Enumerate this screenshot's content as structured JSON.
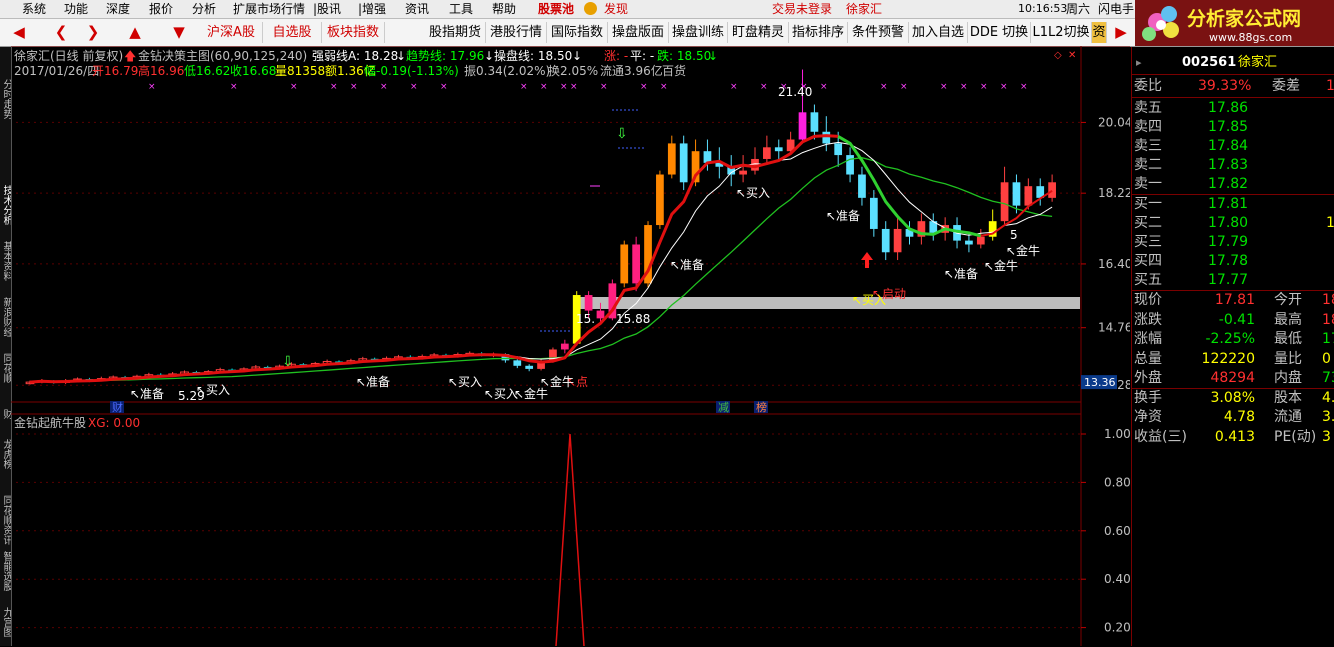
{
  "menubar": {
    "items": [
      "系统",
      "功能",
      "深度",
      "报价",
      "分析",
      "扩展市场行情",
      "|股讯",
      "|增强",
      "资讯",
      "工具",
      "帮助"
    ],
    "stock_pool": "股票池",
    "discover": "发现",
    "login_status": "交易未登录",
    "stock_name": "徐家汇",
    "time": "10:16:53",
    "weekday": "周六",
    "flash_trade": "闪电手"
  },
  "toolbar": {
    "tabs": [
      "沪深A股",
      "自选股",
      "板块指数",
      "股指期货",
      "港股行情",
      "国际指数",
      "操盘版面",
      "操盘训练",
      "盯盘精灵",
      "指标排序",
      "条件预警",
      "加入自选",
      "DDE 切换",
      "L1L2切换",
      "资"
    ]
  },
  "logo": {
    "text": "分析家公式网",
    "url": "www.88gs.com"
  },
  "chart_header": {
    "title": "徐家汇(日线 前复权)",
    "formula": "金钻决策主图(60,90,125,240)",
    "strong_line": "强弱线A: 18.28",
    "trend_line": "趋势线: 17.96",
    "op_line": "操盘线: 18.50",
    "zhang": "涨: -",
    "ping": "平: -",
    "die": "跌: 18.50",
    "info_date": "2017/01/26/四",
    "info_open": "开16.79",
    "info_high": "高16.96",
    "info_low": "低16.62",
    "info_close": "收16.68",
    "info_vol": "量81358",
    "info_amt": "额1.36亿",
    "info_chg": "幅-0.19(-1.13%)",
    "info_amp": "振0.34(2.02%)",
    "info_turn": "换2.05%",
    "info_float": "流通3.96亿",
    "info_sector": "百货"
  },
  "lower_panel": {
    "title": "金钻起航牛股",
    "xg": "XG: 0.00"
  },
  "left_tabs": [
    "分时走势",
    "技术分析",
    "基本资料",
    "新浪财经",
    "同花顺",
    "财",
    "龙虎榜",
    "同花顺资讯",
    "智能选股",
    "九宫图"
  ],
  "quote": {
    "code": "002561",
    "name": "徐家汇",
    "weibi_label": "委比",
    "weibi_value": "39.33%",
    "weicha_label": "委差",
    "weicha_value": "1",
    "sells": [
      {
        "label": "卖五",
        "price": "17.86"
      },
      {
        "label": "卖四",
        "price": "17.85"
      },
      {
        "label": "卖三",
        "price": "17.84"
      },
      {
        "label": "卖二",
        "price": "17.83"
      },
      {
        "label": "卖一",
        "price": "17.82"
      }
    ],
    "buys": [
      {
        "label": "买一",
        "price": "17.81",
        "vol": ""
      },
      {
        "label": "买二",
        "price": "17.80",
        "vol": "1"
      },
      {
        "label": "买三",
        "price": "17.79",
        "vol": ""
      },
      {
        "label": "买四",
        "price": "17.78",
        "vol": ""
      },
      {
        "label": "买五",
        "price": "17.77",
        "vol": ""
      }
    ],
    "stats": [
      {
        "l1": "现价",
        "v1": "17.81",
        "l2": "今开",
        "v2": "18",
        "c1": "#ff3030",
        "c2": "#ff3030"
      },
      {
        "l1": "涨跌",
        "v1": "-0.41",
        "l2": "最高",
        "v2": "18",
        "c1": "#00e000",
        "c2": "#ff3030"
      },
      {
        "l1": "涨幅",
        "v1": "-2.25%",
        "l2": "最低",
        "v2": "17",
        "c1": "#00e000",
        "c2": "#00e000"
      },
      {
        "l1": "总量",
        "v1": "122220",
        "l2": "量比",
        "v2": "0",
        "c1": "#ffff00",
        "c2": "#ffff00"
      },
      {
        "l1": "外盘",
        "v1": "48294",
        "l2": "内盘",
        "v2": "73",
        "c1": "#ff3030",
        "c2": "#00e000"
      },
      {
        "l1": "换手",
        "v1": "3.08%",
        "l2": "股本",
        "v2": "4.1",
        "c1": "#ffff00",
        "c2": "#ffff00"
      },
      {
        "l1": "净资",
        "v1": "4.78",
        "l2": "流通",
        "v2": "3.9",
        "c1": "#ffff00",
        "c2": "#ffff00"
      },
      {
        "l1": "收益(三)",
        "v1": "0.413",
        "l2": "PE(动)",
        "v2": "3",
        "c1": "#ffff00",
        "c2": "#ffff00"
      }
    ]
  },
  "chart_data": {
    "type": "candlestick",
    "price_axis_ticks": [
      "20.04",
      "18.22",
      "16.40",
      "14.76",
      "13.28"
    ],
    "price_ylim": [
      12.9,
      21.8
    ],
    "current_price_tag": "13.36",
    "annotations": {
      "high": "21.40",
      "low_a": "15.88",
      "low_b": "15.",
      "low_c": "5.29",
      "small": "5"
    },
    "signals": [
      "准备",
      "买入",
      "准备",
      "买入",
      "金牛",
      "准备",
      "买入",
      "准备",
      "准备",
      "金牛",
      "启动",
      "金牛",
      "点"
    ],
    "markers": [
      "财",
      "减",
      "榜"
    ],
    "lower_axis_ticks": [
      "1.00",
      "0.80",
      "0.60",
      "0.40",
      "0.20"
    ],
    "lower_ylim": [
      0,
      1.0
    ],
    "xg_spike_value": 1.0,
    "candles": [
      [
        13.32,
        13.36,
        13.3,
        13.4
      ],
      [
        13.36,
        13.4,
        13.33,
        13.44
      ],
      [
        13.38,
        13.35,
        13.32,
        13.41
      ],
      [
        13.35,
        13.39,
        13.31,
        13.44
      ],
      [
        13.39,
        13.44,
        13.36,
        13.48
      ],
      [
        13.44,
        13.4,
        13.36,
        13.47
      ],
      [
        13.4,
        13.45,
        13.38,
        13.5
      ],
      [
        13.45,
        13.49,
        13.41,
        13.53
      ],
      [
        13.49,
        13.46,
        13.42,
        13.52
      ],
      [
        13.46,
        13.51,
        13.43,
        13.55
      ],
      [
        13.51,
        13.55,
        13.47,
        13.6
      ],
      [
        13.55,
        13.52,
        13.48,
        13.59
      ],
      [
        13.52,
        13.57,
        13.49,
        13.62
      ],
      [
        13.57,
        13.62,
        13.54,
        13.66
      ],
      [
        13.62,
        13.58,
        13.54,
        13.65
      ],
      [
        13.58,
        13.63,
        13.55,
        13.67
      ],
      [
        13.63,
        13.68,
        13.6,
        13.73
      ],
      [
        13.68,
        13.64,
        13.6,
        13.71
      ],
      [
        13.64,
        13.7,
        13.61,
        13.74
      ],
      [
        13.7,
        13.75,
        13.66,
        13.8
      ],
      [
        13.75,
        13.71,
        13.67,
        13.78
      ],
      [
        13.71,
        13.77,
        13.68,
        13.81
      ],
      [
        13.77,
        13.82,
        13.73,
        13.87
      ],
      [
        13.82,
        13.78,
        13.74,
        13.85
      ],
      [
        13.78,
        13.84,
        13.75,
        13.88
      ],
      [
        13.84,
        13.89,
        13.8,
        13.94
      ],
      [
        13.89,
        13.85,
        13.81,
        13.92
      ],
      [
        13.85,
        13.91,
        13.82,
        13.96
      ],
      [
        13.91,
        13.96,
        13.87,
        14.01
      ],
      [
        13.96,
        13.92,
        13.88,
        13.99
      ],
      [
        13.92,
        13.97,
        13.89,
        14.02
      ],
      [
        13.97,
        14.01,
        13.93,
        14.06
      ],
      [
        14.01,
        13.97,
        13.93,
        14.05
      ],
      [
        13.97,
        14.02,
        13.94,
        14.07
      ],
      [
        14.02,
        14.06,
        13.98,
        14.11
      ],
      [
        14.06,
        14.02,
        13.98,
        14.09
      ],
      [
        14.02,
        14.07,
        13.99,
        14.12
      ],
      [
        14.07,
        14.1,
        14.03,
        14.15
      ],
      [
        14.1,
        14.06,
        14.02,
        14.13
      ],
      [
        14.06,
        14.08,
        14.0,
        14.12
      ],
      [
        14.08,
        13.92,
        13.86,
        14.1
      ],
      [
        13.92,
        13.78,
        13.72,
        13.95
      ],
      [
        13.78,
        13.7,
        13.64,
        13.82
      ],
      [
        13.7,
        13.9,
        13.66,
        13.94
      ],
      [
        13.9,
        14.2,
        13.86,
        14.25
      ],
      [
        14.2,
        14.35,
        14.1,
        14.45
      ],
      [
        14.35,
        15.6,
        14.3,
        15.7
      ],
      [
        15.6,
        15.2,
        15.0,
        15.7
      ],
      [
        15.2,
        15.0,
        14.9,
        15.4
      ],
      [
        15.0,
        15.9,
        14.95,
        16.0
      ],
      [
        15.9,
        16.9,
        15.8,
        17.0
      ],
      [
        16.9,
        15.9,
        15.7,
        17.1
      ],
      [
        15.9,
        17.4,
        15.8,
        17.5
      ],
      [
        17.4,
        18.7,
        17.3,
        18.8
      ],
      [
        18.7,
        19.5,
        18.6,
        19.7
      ],
      [
        19.5,
        18.5,
        18.3,
        19.7
      ],
      [
        18.5,
        19.3,
        18.4,
        19.6
      ],
      [
        19.3,
        19.0,
        18.8,
        19.6
      ],
      [
        19.0,
        18.9,
        18.6,
        19.4
      ],
      [
        18.9,
        18.7,
        18.4,
        19.2
      ],
      [
        18.7,
        18.8,
        18.5,
        19.2
      ],
      [
        18.8,
        19.1,
        18.7,
        19.4
      ],
      [
        19.1,
        19.4,
        19.0,
        19.7
      ],
      [
        19.4,
        19.3,
        19.1,
        19.6
      ],
      [
        19.3,
        19.6,
        19.2,
        19.8
      ],
      [
        19.6,
        20.3,
        19.5,
        21.4
      ],
      [
        20.3,
        19.8,
        19.6,
        20.5
      ],
      [
        19.8,
        19.5,
        19.3,
        20.2
      ],
      [
        19.5,
        19.2,
        18.9,
        19.8
      ],
      [
        19.2,
        18.7,
        18.5,
        19.4
      ],
      [
        18.7,
        18.1,
        17.9,
        18.9
      ],
      [
        18.1,
        17.3,
        17.1,
        18.3
      ],
      [
        17.3,
        16.7,
        16.5,
        17.5
      ],
      [
        16.7,
        17.3,
        16.5,
        17.6
      ],
      [
        17.3,
        17.1,
        16.9,
        17.5
      ],
      [
        17.1,
        17.5,
        16.9,
        17.7
      ],
      [
        17.5,
        17.2,
        17.0,
        17.7
      ],
      [
        17.2,
        17.4,
        17.0,
        17.6
      ],
      [
        17.4,
        17.0,
        16.8,
        17.6
      ],
      [
        17.0,
        16.9,
        16.7,
        17.2
      ],
      [
        16.9,
        17.1,
        16.8,
        17.3
      ],
      [
        17.1,
        17.5,
        17.0,
        17.8
      ],
      [
        17.5,
        18.5,
        17.4,
        18.9
      ],
      [
        18.5,
        17.9,
        17.7,
        18.7
      ],
      [
        17.9,
        18.4,
        17.8,
        18.6
      ],
      [
        18.4,
        18.1,
        17.9,
        18.6
      ],
      [
        18.1,
        18.5,
        18.0,
        18.7
      ]
    ]
  }
}
